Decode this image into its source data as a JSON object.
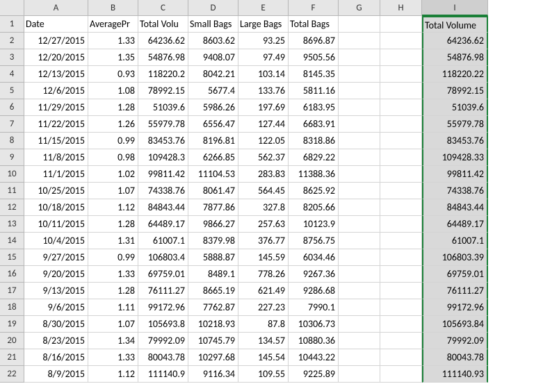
{
  "columns": [
    "A",
    "B",
    "C",
    "D",
    "E",
    "F",
    "G",
    "H",
    "I"
  ],
  "rowNumbers": [
    1,
    2,
    3,
    4,
    5,
    6,
    7,
    8,
    9,
    10,
    11,
    12,
    13,
    14,
    15,
    16,
    17,
    18,
    19,
    20,
    21,
    22
  ],
  "headerRow": {
    "A": "Date",
    "B": "AveragePr",
    "C": "Total Volu",
    "D": "Small Bags",
    "E": "Large Bags",
    "F": "Total Bags",
    "G": "",
    "H": "",
    "I": "Total Volume"
  },
  "rows": [
    {
      "A": "12/27/2015",
      "B": "1.33",
      "C": "64236.62",
      "D": "8603.62",
      "E": "93.25",
      "F": "8696.87",
      "I": "64236.62"
    },
    {
      "A": "12/20/2015",
      "B": "1.35",
      "C": "54876.98",
      "D": "9408.07",
      "E": "97.49",
      "F": "9505.56",
      "I": "54876.98"
    },
    {
      "A": "12/13/2015",
      "B": "0.93",
      "C": "118220.2",
      "D": "8042.21",
      "E": "103.14",
      "F": "8145.35",
      "I": "118220.22"
    },
    {
      "A": "12/6/2015",
      "B": "1.08",
      "C": "78992.15",
      "D": "5677.4",
      "E": "133.76",
      "F": "5811.16",
      "I": "78992.15"
    },
    {
      "A": "11/29/2015",
      "B": "1.28",
      "C": "51039.6",
      "D": "5986.26",
      "E": "197.69",
      "F": "6183.95",
      "I": "51039.6"
    },
    {
      "A": "11/22/2015",
      "B": "1.26",
      "C": "55979.78",
      "D": "6556.47",
      "E": "127.44",
      "F": "6683.91",
      "I": "55979.78"
    },
    {
      "A": "11/15/2015",
      "B": "0.99",
      "C": "83453.76",
      "D": "8196.81",
      "E": "122.05",
      "F": "8318.86",
      "I": "83453.76"
    },
    {
      "A": "11/8/2015",
      "B": "0.98",
      "C": "109428.3",
      "D": "6266.85",
      "E": "562.37",
      "F": "6829.22",
      "I": "109428.33"
    },
    {
      "A": "11/1/2015",
      "B": "1.02",
      "C": "99811.42",
      "D": "11104.53",
      "E": "283.83",
      "F": "11388.36",
      "I": "99811.42"
    },
    {
      "A": "10/25/2015",
      "B": "1.07",
      "C": "74338.76",
      "D": "8061.47",
      "E": "564.45",
      "F": "8625.92",
      "I": "74338.76"
    },
    {
      "A": "10/18/2015",
      "B": "1.12",
      "C": "84843.44",
      "D": "7877.86",
      "E": "327.8",
      "F": "8205.66",
      "I": "84843.44"
    },
    {
      "A": "10/11/2015",
      "B": "1.28",
      "C": "64489.17",
      "D": "9866.27",
      "E": "257.63",
      "F": "10123.9",
      "I": "64489.17"
    },
    {
      "A": "10/4/2015",
      "B": "1.31",
      "C": "61007.1",
      "D": "8379.98",
      "E": "376.77",
      "F": "8756.75",
      "I": "61007.1"
    },
    {
      "A": "9/27/2015",
      "B": "0.99",
      "C": "106803.4",
      "D": "5888.87",
      "E": "145.59",
      "F": "6034.46",
      "I": "106803.39"
    },
    {
      "A": "9/20/2015",
      "B": "1.33",
      "C": "69759.01",
      "D": "8489.1",
      "E": "778.26",
      "F": "9267.36",
      "I": "69759.01"
    },
    {
      "A": "9/13/2015",
      "B": "1.28",
      "C": "76111.27",
      "D": "8665.19",
      "E": "621.49",
      "F": "9286.68",
      "I": "76111.27"
    },
    {
      "A": "9/6/2015",
      "B": "1.11",
      "C": "99172.96",
      "D": "7762.87",
      "E": "227.23",
      "F": "7990.1",
      "I": "99172.96"
    },
    {
      "A": "8/30/2015",
      "B": "1.07",
      "C": "105693.8",
      "D": "10218.93",
      "E": "87.8",
      "F": "10306.73",
      "I": "105693.84"
    },
    {
      "A": "8/23/2015",
      "B": "1.34",
      "C": "79992.09",
      "D": "10745.79",
      "E": "134.57",
      "F": "10880.36",
      "I": "79992.09"
    },
    {
      "A": "8/16/2015",
      "B": "1.33",
      "C": "80043.78",
      "D": "10297.68",
      "E": "145.54",
      "F": "10443.22",
      "I": "80043.78"
    },
    {
      "A": "8/9/2015",
      "B": "1.12",
      "C": "111140.9",
      "D": "9116.34",
      "E": "109.55",
      "F": "9225.89",
      "I": "111140.93"
    }
  ],
  "chart_data": {
    "type": "table",
    "title": "",
    "columns": [
      "Date",
      "AveragePrice",
      "Total Volume",
      "Small Bags",
      "Large Bags",
      "Total Bags",
      "Total Volume (I)"
    ],
    "data": [
      [
        "12/27/2015",
        1.33,
        64236.62,
        8603.62,
        93.25,
        8696.87,
        64236.62
      ],
      [
        "12/20/2015",
        1.35,
        54876.98,
        9408.07,
        97.49,
        9505.56,
        54876.98
      ],
      [
        "12/13/2015",
        0.93,
        118220.2,
        8042.21,
        103.14,
        8145.35,
        118220.22
      ],
      [
        "12/6/2015",
        1.08,
        78992.15,
        5677.4,
        133.76,
        5811.16,
        78992.15
      ],
      [
        "11/29/2015",
        1.28,
        51039.6,
        5986.26,
        197.69,
        6183.95,
        51039.6
      ],
      [
        "11/22/2015",
        1.26,
        55979.78,
        6556.47,
        127.44,
        6683.91,
        55979.78
      ],
      [
        "11/15/2015",
        0.99,
        83453.76,
        8196.81,
        122.05,
        8318.86,
        83453.76
      ],
      [
        "11/8/2015",
        0.98,
        109428.3,
        6266.85,
        562.37,
        6829.22,
        109428.33
      ],
      [
        "11/1/2015",
        1.02,
        99811.42,
        11104.53,
        283.83,
        11388.36,
        99811.42
      ],
      [
        "10/25/2015",
        1.07,
        74338.76,
        8061.47,
        564.45,
        8625.92,
        74338.76
      ],
      [
        "10/18/2015",
        1.12,
        84843.44,
        7877.86,
        327.8,
        8205.66,
        84843.44
      ],
      [
        "10/11/2015",
        1.28,
        64489.17,
        9866.27,
        257.63,
        10123.9,
        64489.17
      ],
      [
        "10/4/2015",
        1.31,
        61007.1,
        8379.98,
        376.77,
        8756.75,
        61007.1
      ],
      [
        "9/27/2015",
        0.99,
        106803.4,
        5888.87,
        145.59,
        6034.46,
        106803.39
      ],
      [
        "9/20/2015",
        1.33,
        69759.01,
        8489.1,
        778.26,
        9267.36,
        69759.01
      ],
      [
        "9/13/2015",
        1.28,
        76111.27,
        8665.19,
        621.49,
        9286.68,
        76111.27
      ],
      [
        "9/6/2015",
        1.11,
        99172.96,
        7762.87,
        227.23,
        7990.1,
        99172.96
      ],
      [
        "8/30/2015",
        1.07,
        105693.8,
        10218.93,
        87.8,
        10306.73,
        105693.84
      ],
      [
        "8/23/2015",
        1.34,
        79992.09,
        10745.79,
        134.57,
        10880.36,
        79992.09
      ],
      [
        "8/16/2015",
        1.33,
        80043.78,
        10297.68,
        145.54,
        10443.22,
        80043.78
      ],
      [
        "8/9/2015",
        1.12,
        111140.9,
        9116.34,
        109.55,
        9225.89,
        111140.93
      ]
    ]
  }
}
